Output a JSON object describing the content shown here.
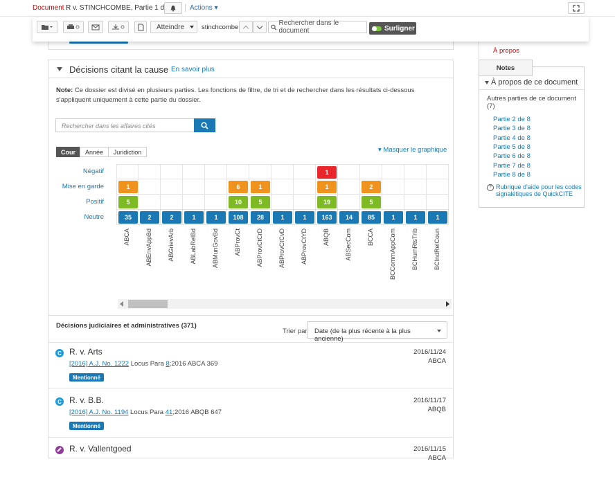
{
  "topbar": {
    "doc_label": "Document :",
    "doc_title": "R v. STINCHCOMBE, Partie 1 de 8",
    "actions_label": "Actions ▾"
  },
  "toolbar": {
    "atteindre_label": "Atteindre",
    "search_term": "stinchcombe",
    "search_placeholder": "Rechercher dans le document",
    "surligner_label": "Surligner"
  },
  "section": {
    "title": "Décisions citant la cause",
    "learn_more": "En savoir plus",
    "note_label": "Note:",
    "note_text": " Ce dossier est divisé en plusieurs parties. Les fonctions de filtre, de tri et de rechercher dans les résultats ci-dessous s'appliquent uniquement à cette partie du dossier.",
    "search_placeholder": "Rechercher dans les affaires cités",
    "segments": [
      "Cour",
      "Année",
      "Juridiction"
    ],
    "chart_toggle": "▾ Masquer le graphique"
  },
  "chart_data": {
    "type": "table",
    "rows": [
      "Négatif",
      "Mise en garde",
      "Positif",
      "Neutre"
    ],
    "columns": [
      "ABCA",
      "ABEnvAppBd",
      "ABGrievArb",
      "ABLabRelBd",
      "ABMunGovBd",
      "ABProvCt",
      "ABProvCtCrD",
      "ABProvCtCvD",
      "ABProvCtYD",
      "ABQB",
      "ABSecCom",
      "BCCA",
      "BCCommAppCom",
      "BCHumRtsTrib",
      "BCIndRelCoun"
    ],
    "values": {
      "Négatif": [
        null,
        null,
        null,
        null,
        null,
        null,
        null,
        null,
        null,
        1,
        null,
        null,
        null,
        null,
        null
      ],
      "Mise en garde": [
        1,
        null,
        null,
        null,
        null,
        6,
        1,
        null,
        null,
        1,
        null,
        2,
        null,
        null,
        null
      ],
      "Positif": [
        5,
        null,
        null,
        null,
        null,
        10,
        5,
        null,
        null,
        19,
        null,
        5,
        null,
        null,
        null
      ],
      "Neutre": [
        35,
        2,
        2,
        1,
        1,
        108,
        28,
        1,
        1,
        163,
        14,
        85,
        1,
        1,
        1
      ]
    },
    "row_colors": {
      "Négatif": "#e8262b",
      "Mise en garde": "#f0931e",
      "Positif": "#7dba23",
      "Neutre": "#1a78b4"
    }
  },
  "list": {
    "title": "Décisions judiciaires et administratives (371)",
    "sort_label": "Trier par:",
    "sort_value": "Date (de la plus récente à la plus ancienne)",
    "cases": [
      {
        "icon": "C",
        "icon_color": "#1a9bd7",
        "name": "R. v. Arts",
        "cite_link": "[2016] A.J. No. 1222",
        "cite_mid": " Locus Para ",
        "para_link": "8",
        "cite_end": ";2016 ABCA 369",
        "date": "2016/11/24",
        "court": "ABCA",
        "tag": "Mentionné"
      },
      {
        "icon": "C",
        "icon_color": "#1a9bd7",
        "name": "R. v. B.B.",
        "cite_link": "[2016] A.J. No. 1194",
        "cite_mid": " Locus Para ",
        "para_link": "41",
        "cite_end": ";2016 ABQB 647",
        "date": "2016/11/17",
        "court": "ABQB",
        "tag": "Mentionné"
      },
      {
        "icon": "",
        "icon_color": "#8e3e98",
        "name": "R. v. Vallentgoed",
        "date": "2016/11/15",
        "court": "ABCA"
      }
    ]
  },
  "sidebar": {
    "apropos_tab": "À propos",
    "notes_tab": "Notes",
    "box_title": "À propos de ce document",
    "other_parts": "Autres parties de ce document (7)",
    "parts": [
      "Partie 2 de 8",
      "Partie 3 de 8",
      "Partie 4 de 8",
      "Partie 5 de 8",
      "Partie 6 de 8",
      "Partie 7 de 8",
      "Partie 8 de 8"
    ],
    "help_link": "Rubrique d'aide pour les codes signalétiques de QuickCITE"
  }
}
